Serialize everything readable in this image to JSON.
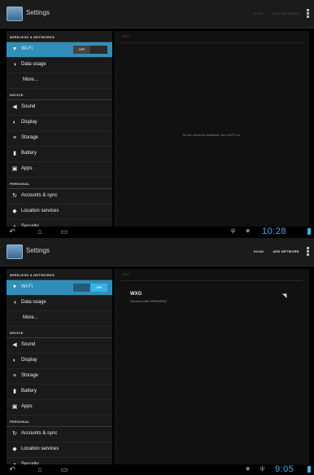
{
  "shots": [
    {
      "title": "Settings",
      "actions": [
        "SCAN",
        "ADD NETWORK"
      ],
      "section_wireless": "WIRELESS & NETWORKS",
      "wifi_label": "Wi-Fi",
      "wifi_toggle": "OFF",
      "data_usage": "Data usage",
      "more": "More...",
      "section_device": "DEVICE",
      "sound": "Sound",
      "display": "Display",
      "storage": "Storage",
      "battery": "Battery",
      "apps": "Apps",
      "section_personal": "PERSONAL",
      "accounts": "Accounts & sync",
      "location": "Location services",
      "security": "Security",
      "panel_header": "Wi-Fi",
      "empty_message": "To see networks available, turn Wi-Fi on.",
      "time": "10:28"
    },
    {
      "title": "Settings",
      "actions": [
        "SCAN",
        "ADD NETWORK"
      ],
      "section_wireless": "WIRELESS & NETWORKS",
      "wifi_label": "Wi-Fi",
      "wifi_toggle": "ON",
      "data_usage": "Data usage",
      "more": "More...",
      "section_device": "DEVICE",
      "sound": "Sound",
      "display": "Display",
      "storage": "Storage",
      "battery": "Battery",
      "apps": "Apps",
      "section_personal": "PERSONAL",
      "accounts": "Accounts & sync",
      "location": "Location services",
      "security": "Security",
      "panel_header": "Wi-Fi",
      "network_ssid": "WXG",
      "network_security": "Secured with WPA/WPA2",
      "time": "9:05"
    }
  ],
  "icons": {
    "wifi": "wifi-icon",
    "data": "data-usage-icon",
    "sound": "speaker-icon",
    "display": "brightness-icon",
    "storage": "storage-icon",
    "battery": "battery-icon",
    "apps": "apps-icon",
    "accounts": "sync-icon",
    "location": "location-icon",
    "security": "lock-icon",
    "back": "back-icon",
    "home": "home-icon",
    "recents": "recents-icon",
    "overflow": "overflow-menu-icon",
    "signal": "wifi-signal-icon",
    "usb": "usb-icon"
  },
  "colors": {
    "accent": "#33b5e5",
    "selected": "#2f8fb8",
    "background": "#000000"
  }
}
